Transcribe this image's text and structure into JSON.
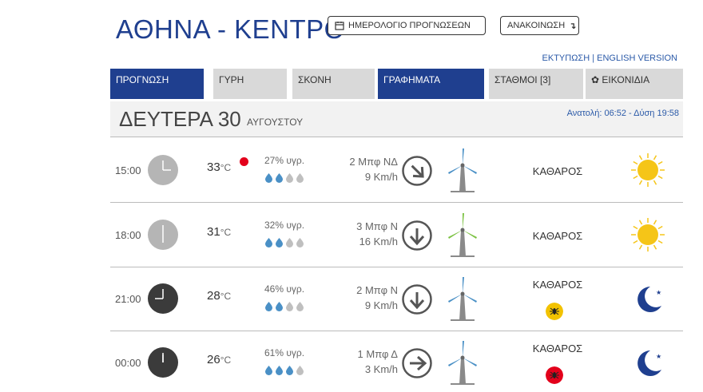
{
  "header": {
    "city_title": "ΑΘΗΝΑ - ΚΕΝΤΡΟ",
    "calendar_button": "ΗΜΕΡΟΛΟΓΙΟ ΠΡΟΓΝΩΣΕΩΝ",
    "announcement_button": "ΑΝΑΚΟΙΝΩΣΗ",
    "print_link": "ΕΚΤΥΠΩΣΗ",
    "link_separator": "|",
    "english_link": "ENGLISH VERSION"
  },
  "tabs": [
    {
      "label": "ΠΡΟΓΝΩΣΗ",
      "active": true
    },
    {
      "label": "ΓΥΡΗ",
      "active": false
    },
    {
      "label": "ΣΚΟΝΗ",
      "active": false
    },
    {
      "label": "ΓΡΑΦΗΜΑΤΑ",
      "active": true
    },
    {
      "label": "ΣΤΑΘΜΟΙ [3]",
      "active": false
    },
    {
      "label": "ΕΙΚΟΝΙΔΙΑ",
      "active": false
    }
  ],
  "day": {
    "name": "ΔΕΥΤΕΡΑ 30",
    "month": "ΑΥΓΟΥΣΤΟΥ",
    "sun_times": "Ανατολή: 06:52  - Δύση 19:58"
  },
  "rows": [
    {
      "time": "15:00",
      "temp": "33",
      "unit": "°C",
      "hot_alert": true,
      "humidity": "27% υγρ.",
      "drops_filled": 2,
      "wind_bft": "2 Μπφ ΝΔ",
      "wind_kmh": "9 Km/h",
      "wind_dir": "ΝΔ",
      "turbine_color": "#4a90c6",
      "condition": "ΚΑΘΑΡΟΣ",
      "mosquito": null,
      "icon": "sun-icon",
      "night": false
    },
    {
      "time": "18:00",
      "temp": "31",
      "unit": "°C",
      "hot_alert": false,
      "humidity": "32% υγρ.",
      "drops_filled": 2,
      "wind_bft": "3 Μπφ Ν",
      "wind_kmh": "16 Km/h",
      "wind_dir": "Ν",
      "turbine_color": "#7cc242",
      "condition": "ΚΑΘΑΡΟΣ",
      "mosquito": null,
      "icon": "sun-icon",
      "night": false
    },
    {
      "time": "21:00",
      "temp": "28",
      "unit": "°C",
      "hot_alert": false,
      "humidity": "46% υγρ.",
      "drops_filled": 2,
      "wind_bft": "2 Μπφ Ν",
      "wind_kmh": "9 Km/h",
      "wind_dir": "Ν",
      "turbine_color": "#4a90c6",
      "condition": "ΚΑΘΑΡΟΣ",
      "mosquito": "#f2c200",
      "icon": "moon-icon",
      "night": true
    },
    {
      "time": "00:00",
      "temp": "26",
      "unit": "°C",
      "hot_alert": false,
      "humidity": "61% υγρ.",
      "drops_filled": 3,
      "wind_bft": "1 Μπφ Δ",
      "wind_kmh": "3 Km/h",
      "wind_dir": "Δ",
      "turbine_color": "#4a90c6",
      "condition": "ΚΑΘΑΡΟΣ",
      "mosquito": "#e3001b",
      "icon": "moon-icon",
      "night": true
    }
  ],
  "colors": {
    "brand": "#1f3f8f",
    "tab_inactive": "#d9d9d9",
    "link": "#2b5aa8",
    "sun": "#f5c518",
    "moon": "#1f3f8f"
  }
}
